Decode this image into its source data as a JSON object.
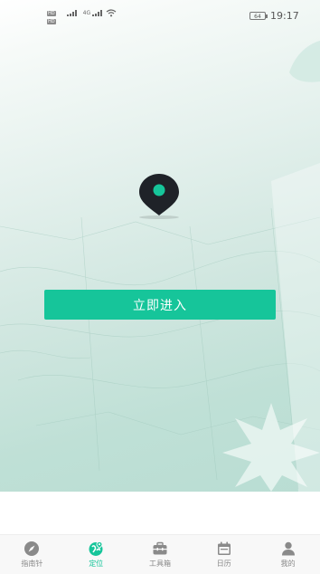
{
  "status_bar": {
    "sim1_hd": "HD",
    "sim2_hd": "HD",
    "network": "4G",
    "time": "19:17",
    "battery": "64"
  },
  "main": {
    "enter_label": "立即进入"
  },
  "colors": {
    "accent": "#16c59a",
    "pin": "#1f2228",
    "tab_inactive": "#888888"
  },
  "tabs": [
    {
      "label": "指南针",
      "icon": "compass-icon",
      "active": false
    },
    {
      "label": "定位",
      "icon": "location-icon",
      "active": true
    },
    {
      "label": "工具箱",
      "icon": "toolbox-icon",
      "active": false
    },
    {
      "label": "日历",
      "icon": "calendar-icon",
      "active": false
    },
    {
      "label": "我的",
      "icon": "profile-icon",
      "active": false
    }
  ]
}
